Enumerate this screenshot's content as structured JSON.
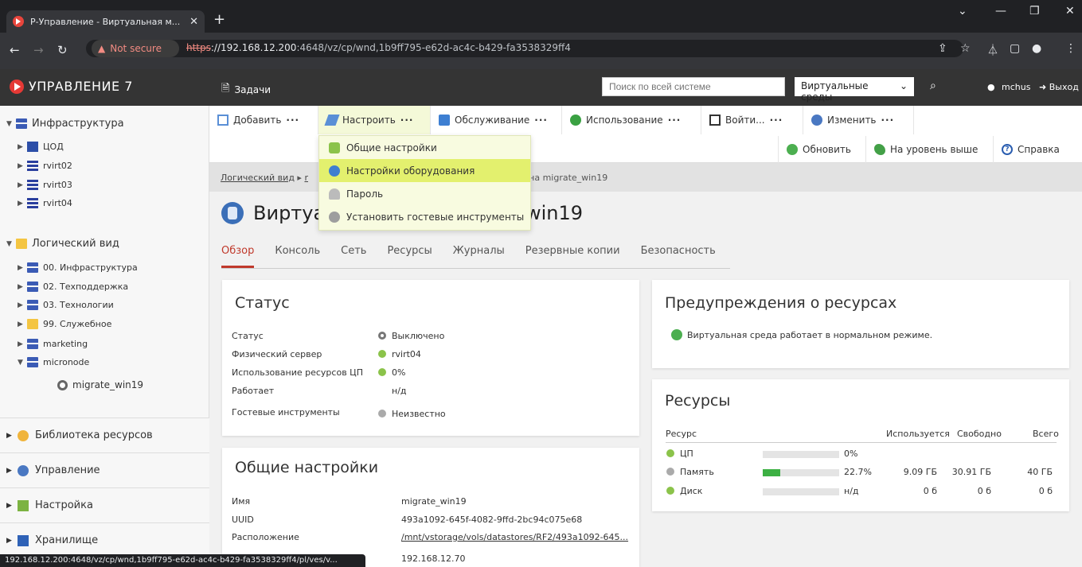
{
  "browser": {
    "tab_title": "Р-Управление - Виртуальная м...",
    "url_scheme": "https",
    "url_host": "://192.168.12.200",
    "url_rest": ":4648/vz/cp/wnd,1b9ff795-e62d-ac4c-b429-fa3538329ff4",
    "not_secure": "Not secure",
    "status_url": "192.168.12.200:4648/vz/cp/wnd,1b9ff795-e62d-ac4c-b429-fa3538329ff4/pl/ves/v..."
  },
  "header": {
    "brand": "УПРАВЛЕНИЕ 7",
    "tasks": "Задачи",
    "search_placeholder": "Поиск по всей системе",
    "scope": "Виртуальные среды",
    "user": "mchus",
    "logout": "Выход"
  },
  "sidebar": {
    "infra": {
      "label": "Инфраструктура",
      "children": [
        "ЦОД",
        "rvirt02",
        "rvirt03",
        "rvirt04"
      ]
    },
    "logical": {
      "label": "Логический вид",
      "children": [
        "00. Инфраструктура",
        "02. Техподдержка",
        "03. Технологии",
        "99. Служебное",
        "marketing",
        "micronode"
      ],
      "vm": "migrate_win19"
    },
    "sections": [
      "Библиотека ресурсов",
      "Управление",
      "Настройка",
      "Хранилище"
    ]
  },
  "toolbar": {
    "buttons": [
      "Добавить",
      "Настроить",
      "Обслуживание",
      "Использование",
      "Войти...",
      "Изменить"
    ],
    "secondary": [
      "Обновить",
      "На уровень выше",
      "Справка"
    ]
  },
  "dropdown": [
    "Общие настройки",
    "Настройки оборудования",
    "Пароль",
    "Установить гостевые инструменты"
  ],
  "breadcrumb": {
    "first": "Логический вид",
    "sep": "▸",
    "partial": "r",
    "tail": "ина migrate_win19"
  },
  "page": {
    "title_left": "Виртуа",
    "title_right": "_win19",
    "tabs": [
      "Обзор",
      "Консоль",
      "Сеть",
      "Ресурсы",
      "Журналы",
      "Резервные копии",
      "Безопасность"
    ]
  },
  "status": {
    "title": "Статус",
    "rows": [
      {
        "k": "Статус",
        "v": "Выключено"
      },
      {
        "k": "Физический сервер",
        "v": "rvirt04"
      },
      {
        "k": "Использование ресурсов ЦП",
        "v": "0%"
      },
      {
        "k": "Работает",
        "v": "н/д"
      },
      {
        "k": "Гостевые инструменты",
        "v": "Неизвестно"
      }
    ]
  },
  "general": {
    "title": "Общие настройки",
    "rows": [
      {
        "k": "Имя",
        "v": "migrate_win19"
      },
      {
        "k": "UUID",
        "v": "493a1092-645f-4082-9ffd-2bc94c075e68"
      },
      {
        "k": "Расположение",
        "v": "/mnt/vstorage/vols/datastores/RF2/493a1092-645..."
      },
      {
        "k": "",
        "v": "192.168.12.70"
      }
    ]
  },
  "warnings": {
    "title": "Предупреждения о ресурсах",
    "message": "Виртуальная среда работает в нормальном режиме."
  },
  "resources": {
    "title": "Ресурсы",
    "headers": {
      "res": "Ресурс",
      "used": "Используется",
      "free": "Свободно",
      "total": "Всего"
    },
    "rows": [
      {
        "name": "ЦП",
        "pct": "0%",
        "fill": 0,
        "used": "",
        "free": "",
        "total": ""
      },
      {
        "name": "Память",
        "pct": "22.7%",
        "fill": 0.227,
        "used": "9.09 ГБ",
        "free": "30.91 ГБ",
        "total": "40 ГБ"
      },
      {
        "name": "Диск",
        "pct": "н/д",
        "fill": 0,
        "used": "0 б",
        "free": "0 б",
        "total": "0 б"
      }
    ]
  },
  "colors": {
    "accent": "#c0392b",
    "header": "#343434",
    "ok": "#8bc34a",
    "menu_highlight": "#e3f06e"
  }
}
